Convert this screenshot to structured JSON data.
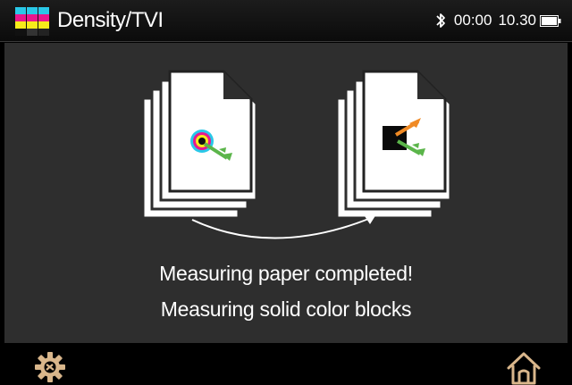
{
  "header": {
    "title": "Density/TVI",
    "logo_icon": "cmyk-patch-logo-icon",
    "status": {
      "bluetooth_icon": "bluetooth-icon",
      "clock": "00:00",
      "level": "10.30",
      "battery_icon": "battery-icon"
    }
  },
  "main": {
    "illustration": {
      "source_icon": "paper-target-icon",
      "target_icon": "solid-color-block-icon",
      "arrow_icon": "curved-arrow-icon"
    },
    "messages": {
      "line1": "Measuring paper completed!",
      "line2": "Measuring solid color blocks"
    }
  },
  "footer": {
    "settings_icon": "settings-gear-icon",
    "home_icon": "home-icon"
  },
  "colors": {
    "panel_bg": "#2e2e2e",
    "bar_bg": "#000000",
    "text": "#ffffff",
    "accent_footer_icon": "#d9b68b",
    "cyan": "#29c8e8",
    "magenta": "#e8178e",
    "yellow": "#f7ea1a",
    "green_arrow": "#5bb54a",
    "orange_arrow": "#f08a24"
  }
}
